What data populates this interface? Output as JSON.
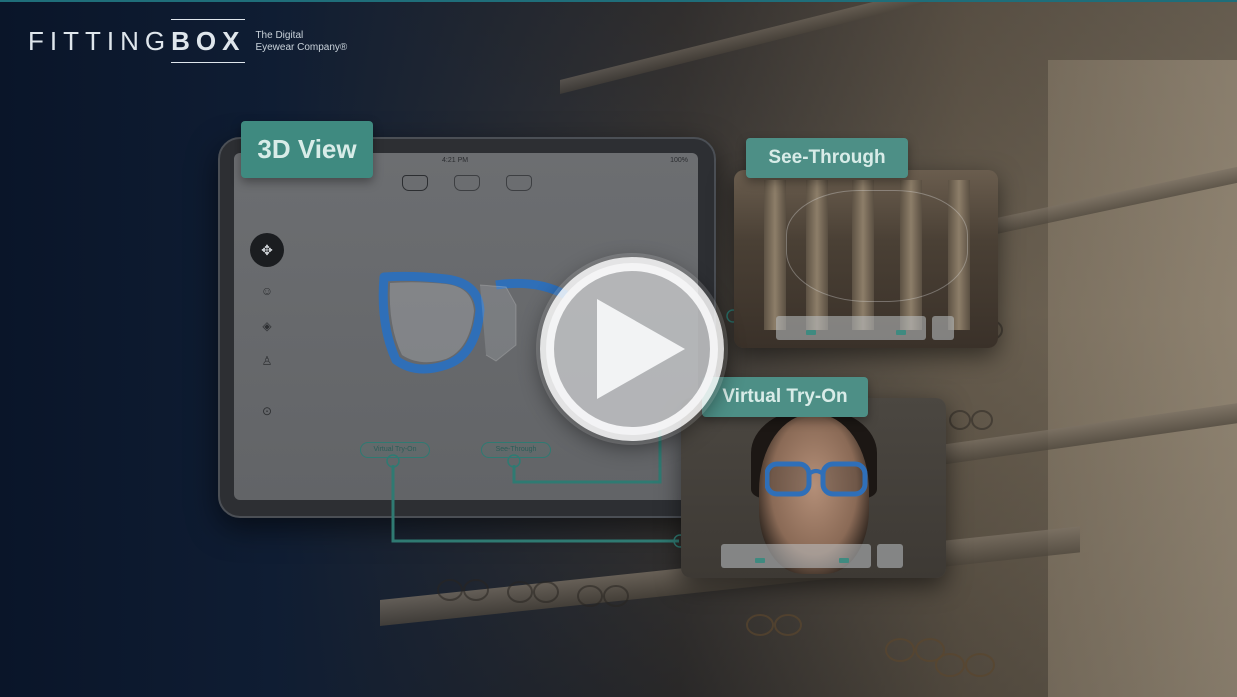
{
  "brand": {
    "name_part1": "FITTI",
    "name_part2": "NG",
    "name_part3": "BOX",
    "tagline_line1": "The Digital",
    "tagline_line2": "Eyewear Company®"
  },
  "labels": {
    "view_3d": "3D View",
    "see_through": "See-Through",
    "virtual_try_on": "Virtual Try-On"
  },
  "tablet": {
    "time": "4:21 PM",
    "battery": "100%",
    "pill_vto": "Virtual Try-On",
    "pill_st": "See-Through"
  },
  "colors": {
    "accent": "#4d8f86",
    "frame": "#2f6fb8"
  },
  "icons": {
    "play": "play-icon",
    "tools": [
      "move-icon",
      "face-icon",
      "color-icon",
      "pose-icon",
      "capture-icon"
    ]
  }
}
